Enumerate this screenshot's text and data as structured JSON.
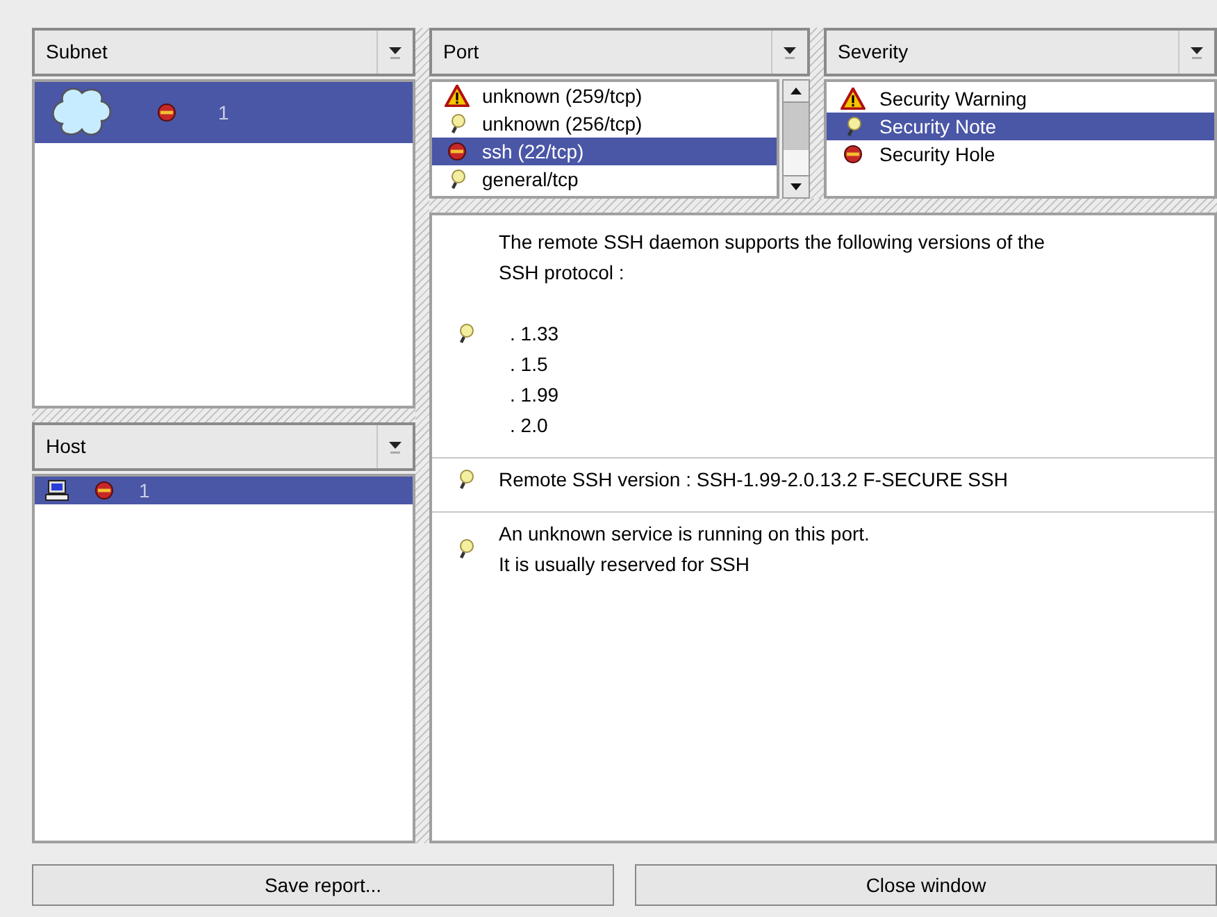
{
  "subnet": {
    "header": "Subnet",
    "items": [
      {
        "kind": "hole",
        "label": "1",
        "selected": true
      }
    ]
  },
  "host": {
    "header": "Host",
    "items": [
      {
        "kind": "hole",
        "label": "1",
        "selected": true
      }
    ]
  },
  "port": {
    "header": "Port",
    "items": [
      {
        "kind": "warning",
        "label": "unknown (259/tcp)",
        "selected": false
      },
      {
        "kind": "note",
        "label": "unknown (256/tcp)",
        "selected": false
      },
      {
        "kind": "hole",
        "label": "ssh (22/tcp)",
        "selected": true
      },
      {
        "kind": "note",
        "label": "general/tcp",
        "selected": false
      }
    ]
  },
  "severity": {
    "header": "Severity",
    "items": [
      {
        "kind": "warning",
        "label": "Security Warning",
        "selected": false
      },
      {
        "kind": "note",
        "label": "Security Note",
        "selected": true
      },
      {
        "kind": "hole",
        "label": "Security Hole",
        "selected": false
      }
    ]
  },
  "report": [
    {
      "kind": "note",
      "lines": [
        "The remote SSH daemon supports the following versions of the",
        "SSH protocol :"
      ],
      "items": [
        ". 1.33",
        ". 1.5",
        ". 1.99",
        ". 2.0"
      ]
    },
    {
      "kind": "note",
      "lines": [
        "Remote SSH version : SSH-1.99-2.0.13.2 F-SECURE SSH"
      ]
    },
    {
      "kind": "note",
      "lines": [
        "An unknown service is running on this port.",
        "It is usually reserved for SSH"
      ]
    }
  ],
  "buttons": [
    "Save report...",
    "Close window"
  ]
}
